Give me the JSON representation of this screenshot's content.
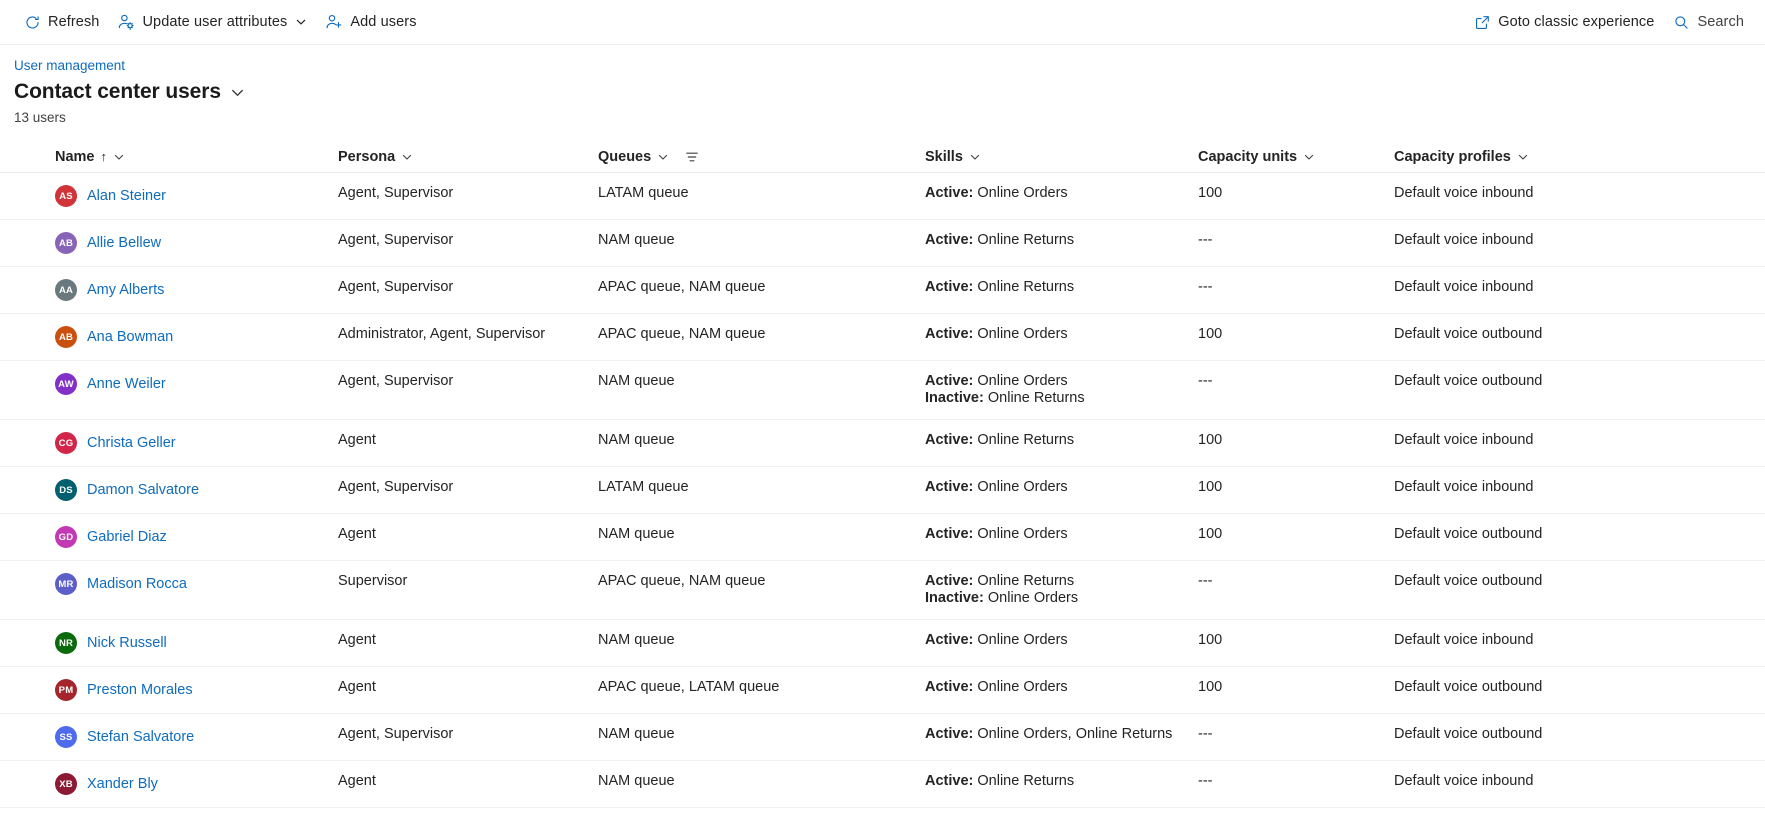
{
  "toolbar": {
    "refresh": {
      "label": "Refresh",
      "icon": "refresh-icon"
    },
    "update_user_attributes": {
      "label": "Update user attributes",
      "icon": "person-settings-icon",
      "has_chevron": true
    },
    "add_users": {
      "label": "Add users",
      "icon": "person-add-icon"
    },
    "goto_classic": {
      "label": "Goto classic experience",
      "icon": "open-external-icon"
    },
    "search": {
      "label": "Search",
      "icon": "search-icon"
    }
  },
  "header": {
    "breadcrumb": "User management",
    "title": "Contact center users",
    "count": "13 users"
  },
  "table": {
    "columns": [
      {
        "key": "name",
        "label": "Name",
        "sorted": true,
        "sort_arrow": "↑",
        "has_filter": false
      },
      {
        "key": "persona",
        "label": "Persona",
        "sorted": false,
        "has_filter": false
      },
      {
        "key": "queues",
        "label": "Queues",
        "sorted": false,
        "has_filter": true
      },
      {
        "key": "skills",
        "label": "Skills",
        "sorted": false,
        "has_filter": false
      },
      {
        "key": "capacity_units",
        "label": "Capacity units",
        "sorted": false,
        "has_filter": false
      },
      {
        "key": "capacity_profiles",
        "label": "Capacity profiles",
        "sorted": false,
        "has_filter": false
      }
    ],
    "rows": [
      {
        "initials": "AS",
        "avatar_color": "#d13438",
        "name": "Alan Steiner",
        "persona": "Agent, Supervisor",
        "queues": "LATAM queue",
        "skills": [
          {
            "state": "Active:",
            "value": "Online Orders"
          }
        ],
        "capacity_units": "100",
        "capacity_profiles": "Default voice inbound"
      },
      {
        "initials": "AB",
        "avatar_color": "#8764b8",
        "name": "Allie Bellew",
        "persona": "Agent, Supervisor",
        "queues": "NAM queue",
        "skills": [
          {
            "state": "Active:",
            "value": "Online Returns"
          }
        ],
        "capacity_units": "---",
        "capacity_profiles": "Default voice inbound"
      },
      {
        "initials": "AA",
        "avatar_color": "#69797e",
        "name": "Amy Alberts",
        "persona": "Agent, Supervisor",
        "queues": "APAC queue, NAM queue",
        "skills": [
          {
            "state": "Active:",
            "value": "Online Returns"
          }
        ],
        "capacity_units": "---",
        "capacity_profiles": "Default voice inbound"
      },
      {
        "initials": "AB",
        "avatar_color": "#ca5010",
        "name": "Ana Bowman",
        "persona": "Administrator, Agent, Supervisor",
        "queues": "APAC queue, NAM queue",
        "skills": [
          {
            "state": "Active:",
            "value": "Online Orders"
          }
        ],
        "capacity_units": "100",
        "capacity_profiles": "Default voice outbound"
      },
      {
        "initials": "AW",
        "avatar_color": "#8230c6",
        "name": "Anne Weiler",
        "persona": "Agent, Supervisor",
        "queues": "NAM queue",
        "skills": [
          {
            "state": "Active:",
            "value": "Online Orders"
          },
          {
            "state": "Inactive:",
            "value": "Online Returns"
          }
        ],
        "capacity_units": "---",
        "capacity_profiles": "Default voice outbound"
      },
      {
        "initials": "CG",
        "avatar_color": "#d1264a",
        "name": "Christa Geller",
        "persona": "Agent",
        "queues": "NAM queue",
        "skills": [
          {
            "state": "Active:",
            "value": "Online Returns"
          }
        ],
        "capacity_units": "100",
        "capacity_profiles": "Default voice inbound"
      },
      {
        "initials": "DS",
        "avatar_color": "#006070",
        "name": "Damon Salvatore",
        "persona": "Agent, Supervisor",
        "queues": "LATAM queue",
        "skills": [
          {
            "state": "Active:",
            "value": "Online Orders"
          }
        ],
        "capacity_units": "100",
        "capacity_profiles": "Default voice inbound"
      },
      {
        "initials": "GD",
        "avatar_color": "#c239b3",
        "name": "Gabriel Diaz",
        "persona": "Agent",
        "queues": "NAM queue",
        "skills": [
          {
            "state": "Active:",
            "value": "Online Orders"
          }
        ],
        "capacity_units": "100",
        "capacity_profiles": "Default voice outbound"
      },
      {
        "initials": "MR",
        "avatar_color": "#5b5fc7",
        "name": "Madison Rocca",
        "persona": "Supervisor",
        "queues": "APAC queue, NAM queue",
        "skills": [
          {
            "state": "Active:",
            "value": "Online Returns"
          },
          {
            "state": "Inactive:",
            "value": "Online Orders"
          }
        ],
        "capacity_units": "---",
        "capacity_profiles": "Default voice outbound"
      },
      {
        "initials": "NR",
        "avatar_color": "#0b6a0b",
        "name": "Nick Russell",
        "persona": "Agent",
        "queues": "NAM queue",
        "skills": [
          {
            "state": "Active:",
            "value": "Online Orders"
          }
        ],
        "capacity_units": "100",
        "capacity_profiles": "Default voice inbound"
      },
      {
        "initials": "PM",
        "avatar_color": "#a4262c",
        "name": "Preston Morales",
        "persona": "Agent",
        "queues": "APAC queue, LATAM queue",
        "skills": [
          {
            "state": "Active:",
            "value": "Online Orders"
          }
        ],
        "capacity_units": "100",
        "capacity_profiles": "Default voice outbound"
      },
      {
        "initials": "SS",
        "avatar_color": "#4f6bed",
        "name": "Stefan Salvatore",
        "persona": "Agent, Supervisor",
        "queues": "NAM queue",
        "skills": [
          {
            "state": "Active:",
            "value": "Online Orders, Online Returns"
          }
        ],
        "capacity_units": "---",
        "capacity_profiles": "Default voice outbound"
      },
      {
        "initials": "XB",
        "avatar_color": "#8b1a32",
        "name": "Xander Bly",
        "persona": "Agent",
        "queues": "NAM queue",
        "skills": [
          {
            "state": "Active:",
            "value": "Online Returns"
          }
        ],
        "capacity_units": "---",
        "capacity_profiles": "Default voice inbound"
      }
    ]
  },
  "colors": {
    "link": "#0f6cbd",
    "icon_accent": "#0f6cbd",
    "text": "#242424",
    "row_border": "#f0f0f0"
  }
}
